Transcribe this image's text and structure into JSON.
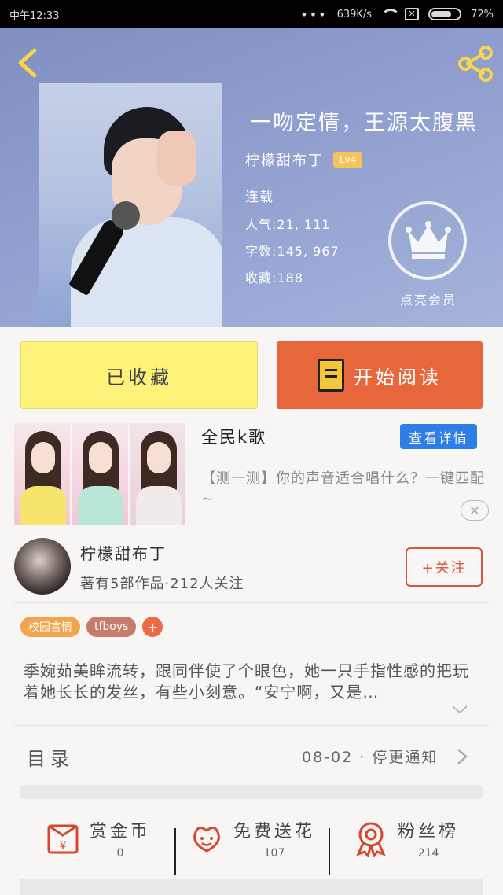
{
  "status_bar": {
    "time": "中午12:33",
    "dots": "•••",
    "network_speed": "639K/s",
    "battery": "72%"
  },
  "book": {
    "title": "一吻定情，王源太腹黑",
    "author": "柠檬甜布丁",
    "level": "Lv4",
    "status": "连载",
    "popularity": "人气:21, 111",
    "word_count": "字数:145, 967",
    "favorites": "收藏:188"
  },
  "vip": {
    "label": "点亮会员"
  },
  "actions": {
    "collected_label": "已收藏",
    "read_label": "开始阅读"
  },
  "ad": {
    "title": "全民k歌",
    "detail_button": "查看详情",
    "description": "【测一测】你的声音适合唱什么？一键匹配~",
    "close": "✕"
  },
  "author_info": {
    "name": "柠檬甜布丁",
    "stats": "著有5部作品·212人关注",
    "follow_label": "+关注"
  },
  "tags": [
    "校园言情",
    "tfboys",
    "+"
  ],
  "synopsis": "季婉茹美眸流转，跟同伴使了个眼色，她一只手指性感的把玩着她长长的发丝，有些小刻意。“安宁啊，又是…",
  "catalog": {
    "label": "目录",
    "info": "08-02 · 停更通知"
  },
  "bottom": [
    {
      "icon": "coin-envelope-icon",
      "label": "赏金币",
      "count": "0"
    },
    {
      "icon": "flower-icon",
      "label": "免费送花",
      "count": "107"
    },
    {
      "icon": "rosette-icon",
      "label": "粉丝榜",
      "count": "214"
    }
  ],
  "colors": {
    "header_bg": "#8e9dcd",
    "collected_bg": "#fdf27a",
    "read_bg": "#e8663c",
    "detail_blue": "#2f7ee8",
    "follow_red": "#d8553f",
    "icon_red": "#d9452f"
  }
}
